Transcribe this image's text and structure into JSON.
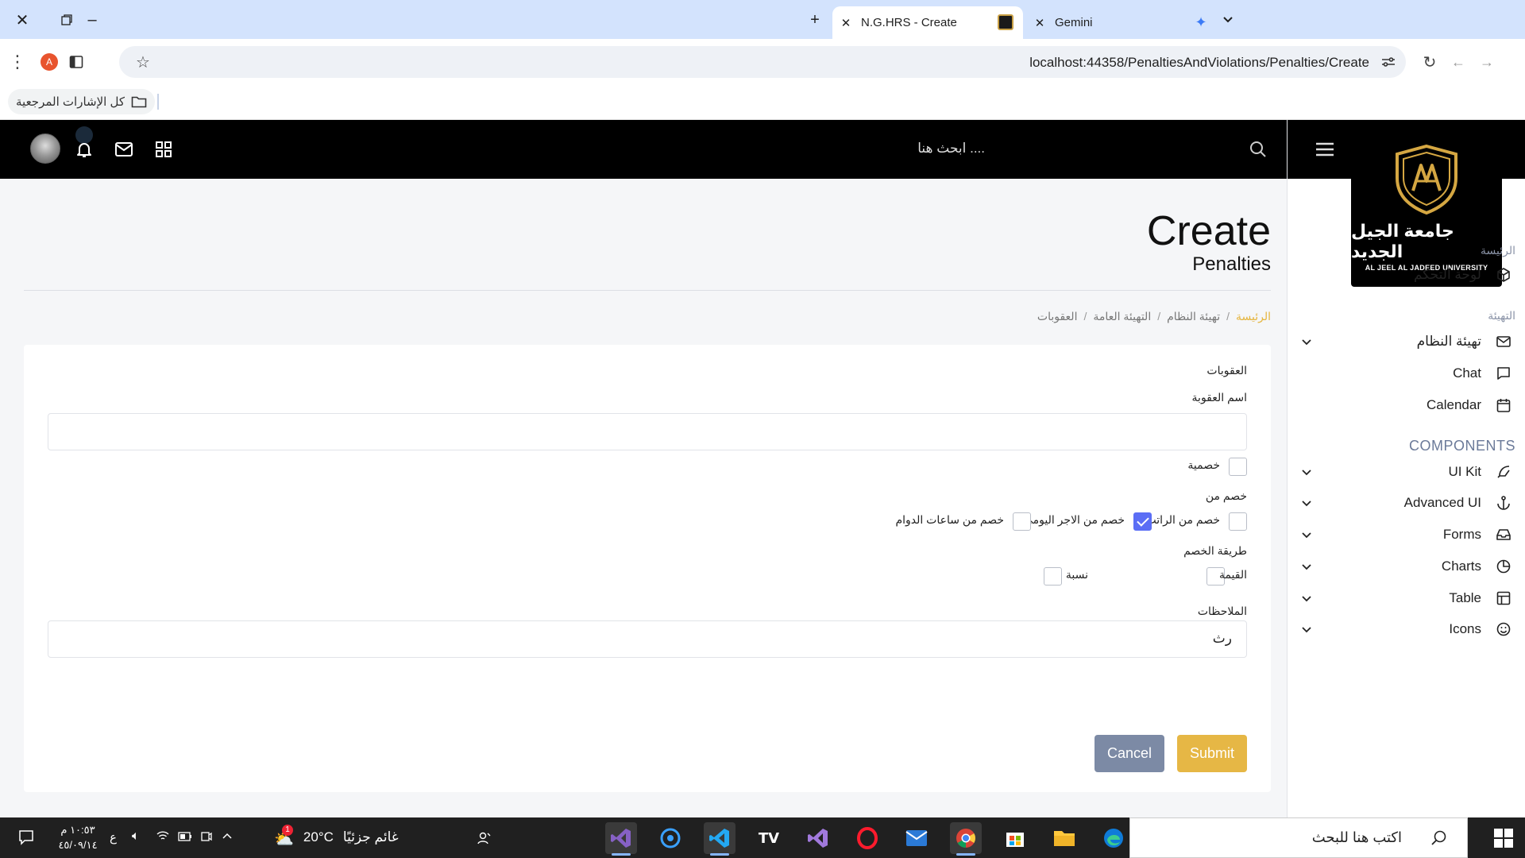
{
  "browser": {
    "tabs": [
      {
        "title": "N.G.HRS - Create",
        "active": true
      },
      {
        "title": "Gemini",
        "active": false
      }
    ],
    "url": "localhost:44358/PenaltiesAndViolations/Penalties/Create",
    "profile_initial": "A",
    "bookmarks_all_label": "كل الإشارات المرجعية"
  },
  "header": {
    "search_placeholder": "ابحث هنا ...."
  },
  "logo": {
    "arabic": "جامعة الجيل الجديد",
    "english": "AL JEEL AL JADEED UNIVERSITY"
  },
  "sidebar": {
    "section_main": "الرئيسة",
    "dashboard": "لوحة التحكم",
    "section_setup": "التهيئة",
    "system_setup": "تهيئة النظام",
    "chat": "Chat",
    "calendar": "Calendar",
    "section_components": "COMPONENTS",
    "ui_kit": "UI Kit",
    "advanced_ui": "Advanced UI",
    "forms": "Forms",
    "charts": "Charts",
    "table": "Table",
    "icons": "Icons"
  },
  "page": {
    "title": "Create",
    "subtitle": "Penalties",
    "breadcrumb": [
      "الرئيسة",
      "تهيئة النظام",
      "التهيئة العامة",
      "العقوبات"
    ]
  },
  "form": {
    "heading": "العقوبات",
    "name_label": "اسم العقوبة",
    "name_value": "",
    "discount_label": "خصمية",
    "discount_checked": false,
    "deduct_from_label": "خصم من",
    "deduct_salary": "خصم من الراتب",
    "deduct_salary_checked": false,
    "deduct_daily": "خصم من الاجر اليومي",
    "deduct_daily_checked": true,
    "deduct_hours": "خصم من ساعات الدوام",
    "deduct_hours_checked": false,
    "method_label": "طريقة الخصم",
    "method_value": "القيمة",
    "method_value_checked": false,
    "method_percent": "نسبة",
    "method_percent_checked": false,
    "notes_label": "الملاحظات",
    "notes_value": "رث",
    "submit": "Submit",
    "cancel": "Cancel"
  },
  "taskbar": {
    "search_placeholder": "اكتب هنا للبحث",
    "weather_temp": "20°C",
    "weather_text": "غائم جزئيًا",
    "weather_badge": "1",
    "lang": "ع",
    "time": "١٠:٥٣ م",
    "date": "٤٥/٠٩/١٤"
  }
}
